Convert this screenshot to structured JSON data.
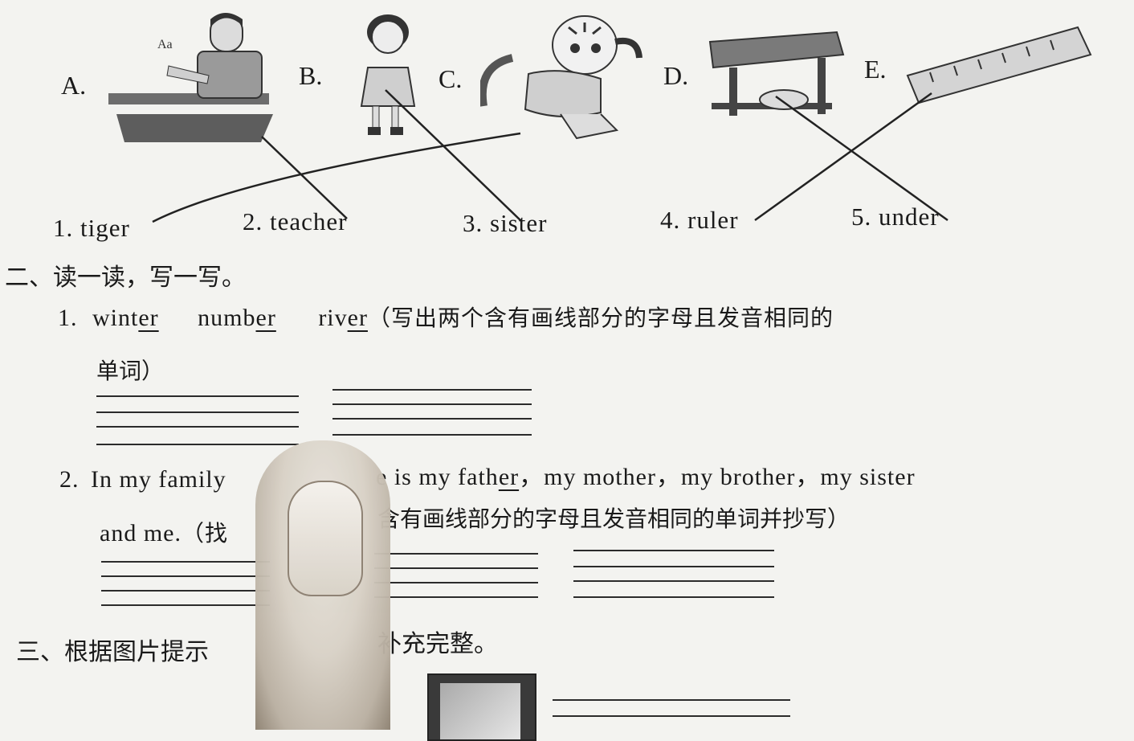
{
  "options": [
    {
      "letter": "A.",
      "icon": "teacher-at-desk-icon"
    },
    {
      "letter": "B.",
      "icon": "girl-icon"
    },
    {
      "letter": "C.",
      "icon": "tiger-icon"
    },
    {
      "letter": "D.",
      "icon": "desk-with-ball-under-icon"
    },
    {
      "letter": "E.",
      "icon": "ruler-icon"
    }
  ],
  "words": [
    "1. tiger",
    "2. teacher",
    "3. sister",
    "4. ruler",
    "5. under"
  ],
  "section2": {
    "heading": "二、读一读，写一写。",
    "q1": {
      "num": "1.",
      "w1_pre": "wint",
      "w1_u": "er",
      "w2_pre": "numb",
      "w2_u": "er",
      "w3_pre": "riv",
      "w3_u": "er",
      "instruction": "（写出两个含有画线部分的字母且发音相同的",
      "instruction2": "单词）"
    },
    "q2": {
      "num": "2.",
      "pre": "In my family",
      "mid": "e is my fath",
      "u": "er",
      "post": "，my mother，my brother，my sister",
      "line2_en": "and me.",
      "line2_cn_a": "（找",
      "line2_cn_b": "含有画线部分的字母且发音相同的单词并抄写）"
    }
  },
  "section3": {
    "heading_a": "三、根据图片提示",
    "heading_b": "补充完整。"
  }
}
